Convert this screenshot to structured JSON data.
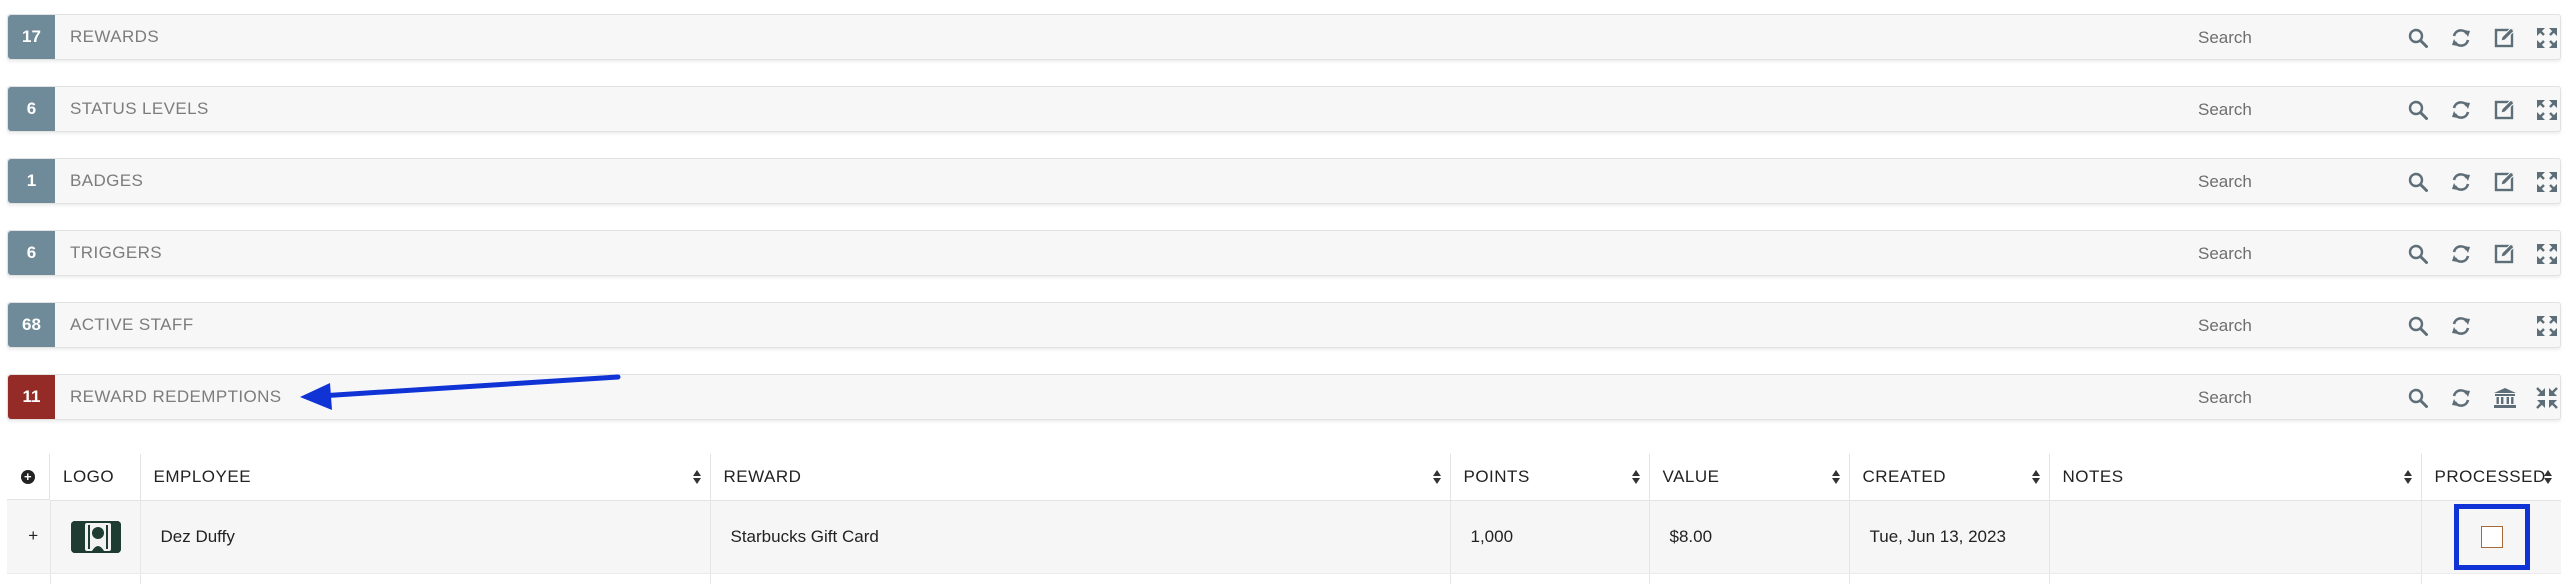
{
  "panels": [
    {
      "count": "17",
      "title": "REWARDS",
      "search_placeholder": "Search",
      "active": false,
      "icons": [
        "search-icon",
        "refresh-icon",
        "edit-icon",
        "expand-icon"
      ]
    },
    {
      "count": "6",
      "title": "STATUS LEVELS",
      "search_placeholder": "Search",
      "active": false,
      "icons": [
        "search-icon",
        "refresh-icon",
        "edit-icon",
        "expand-icon"
      ]
    },
    {
      "count": "1",
      "title": "BADGES",
      "search_placeholder": "Search",
      "active": false,
      "icons": [
        "search-icon",
        "refresh-icon",
        "edit-icon",
        "expand-icon"
      ]
    },
    {
      "count": "6",
      "title": "TRIGGERS",
      "search_placeholder": "Search",
      "active": false,
      "icons": [
        "search-icon",
        "refresh-icon",
        "edit-icon",
        "expand-icon"
      ]
    },
    {
      "count": "68",
      "title": "ACTIVE STAFF",
      "search_placeholder": "Search",
      "active": false,
      "icons": [
        "search-icon",
        "refresh-icon",
        "expand-icon"
      ]
    },
    {
      "count": "11",
      "title": "REWARD REDEMPTIONS",
      "search_placeholder": "Search",
      "active": true,
      "icons": [
        "search-icon",
        "refresh-icon",
        "bank-icon",
        "collapse-icon"
      ]
    }
  ],
  "colors": {
    "badge": "#6f8a98",
    "badge_active": "#952b27",
    "icon": "#5d6e78",
    "annotation": "#1033d6"
  },
  "table": {
    "columns": [
      "LOGO",
      "EMPLOYEE",
      "REWARD",
      "POINTS",
      "VALUE",
      "CREATED",
      "NOTES",
      "PROCESSED"
    ],
    "rows": [
      {
        "logo": "starbucks-logo",
        "employee": "Dez Duffy",
        "reward": "Starbucks Gift Card",
        "points": "1,000",
        "value": "$8.00",
        "created": "Tue, Jun 13, 2023",
        "notes": "",
        "processed": false
      }
    ]
  }
}
